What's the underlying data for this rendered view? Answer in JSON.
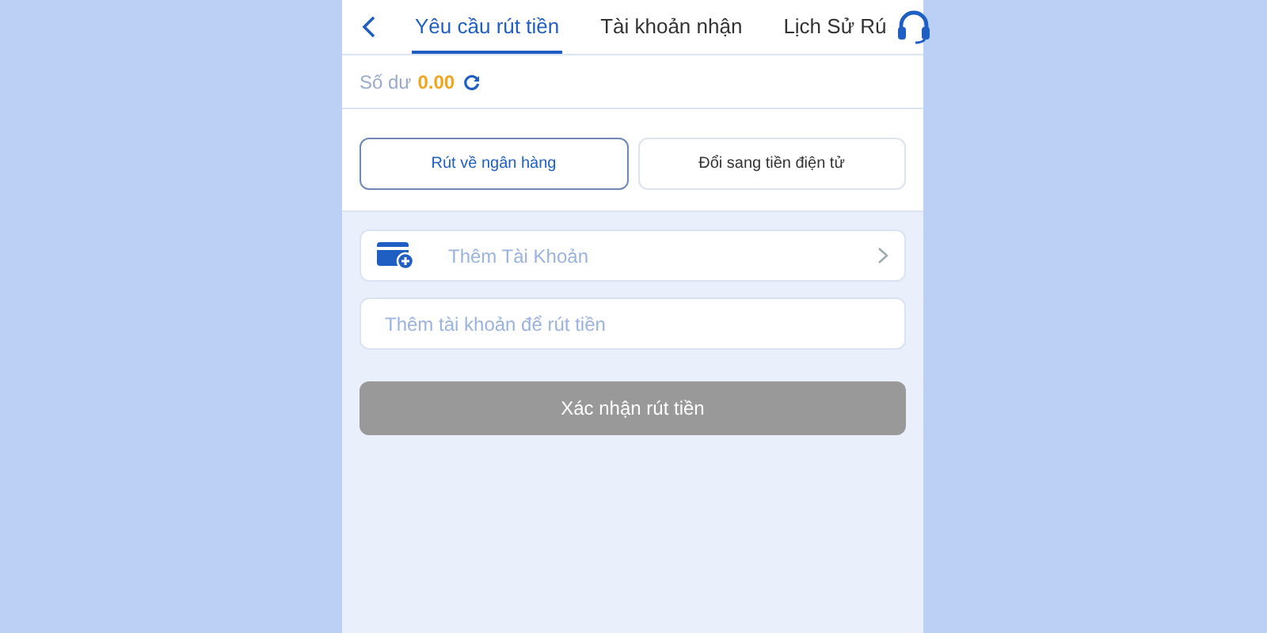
{
  "tabs": [
    {
      "label": "Yêu cầu rút tiền",
      "selected": true
    },
    {
      "label": "Tài khoản nhận",
      "selected": false
    },
    {
      "label": "Lịch Sử Rú",
      "selected": false
    }
  ],
  "balance": {
    "label": "Số dư",
    "amount": "0.00"
  },
  "methods": [
    {
      "label": "Rút về ngân hàng",
      "selected": true
    },
    {
      "label": "Đổi sang tiền điện tử",
      "selected": false
    }
  ],
  "add_account": {
    "label": "Thêm Tài Khoản"
  },
  "account_field": {
    "placeholder": "Thêm tài khoản để rút tiền"
  },
  "confirm_button": {
    "label": "Xác nhận rút tiền",
    "disabled": true
  }
}
